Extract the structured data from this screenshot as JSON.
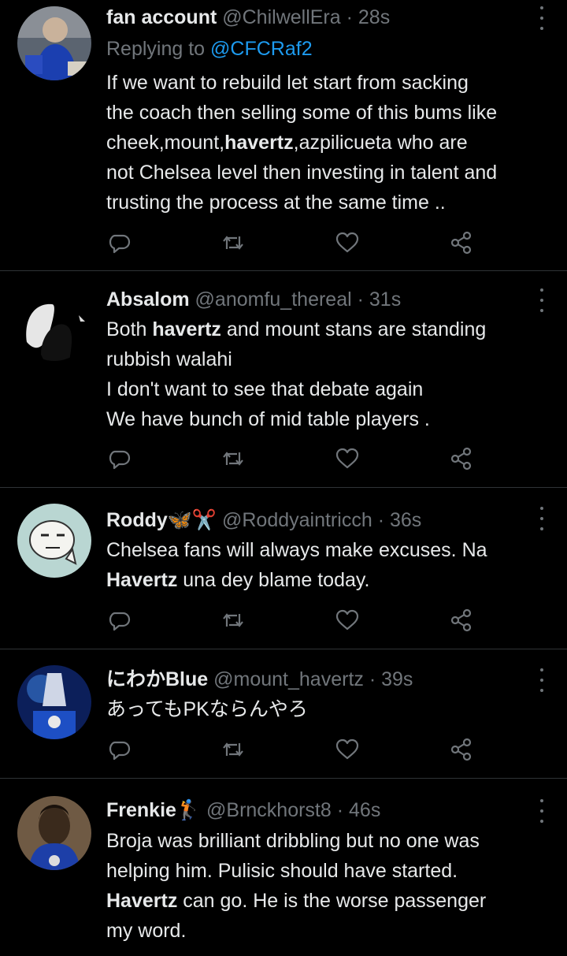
{
  "tweets": [
    {
      "name": "fan account",
      "handle": "@ChilwellEra",
      "dot": "·",
      "time": "28s",
      "reply_prefix": "Replying to ",
      "reply_handle": "@CFCRaf2",
      "lines": [
        [
          "If we want to rebuild let start from sacking"
        ],
        [
          "the coach then selling some of this bums like"
        ],
        [
          "cheek,mount,",
          "havertz",
          ",azpilicueta who are"
        ],
        [
          "not Chelsea level then investing in talent and"
        ],
        [
          "trusting the process at the same time .."
        ]
      ]
    },
    {
      "name": "Absalom",
      "handle": "@anomfu_thereal",
      "dot": "·",
      "time": "31s",
      "lines": [
        [
          "Both ",
          "havertz",
          " and mount stans are standing"
        ],
        [
          "rubbish walahi"
        ],
        [
          "I don't want to see that debate again"
        ],
        [
          "We have bunch of mid table players  ."
        ]
      ]
    },
    {
      "name": "Roddy🦋✂️",
      "handle": "@Roddyaintricch",
      "dot": "·",
      "time": "36s",
      "lines": [
        [
          "Chelsea fans will always make excuses. Na"
        ],
        [
          "",
          "Havertz",
          " una dey blame today."
        ]
      ]
    },
    {
      "name": "にわかBlue",
      "handle": "@mount_havertz",
      "dot": "·",
      "time": "39s",
      "lines": [
        [
          "あってもPKならんやろ"
        ]
      ]
    },
    {
      "name": "Frenkie🏌",
      "handle": "@Brnckhorst8",
      "dot": "·",
      "time": "46s",
      "lines": [
        [
          "Broja was brilliant dribbling but no one was"
        ],
        [
          "helping him. Pulisic should have started."
        ],
        [
          "",
          "Havertz",
          " can go. He is the worse passenger"
        ],
        [
          "my word."
        ]
      ]
    }
  ],
  "icons": {
    "reply": "reply-icon",
    "retweet": "retweet-icon",
    "like": "like-icon",
    "share": "share-icon",
    "more": "more-icon"
  },
  "colors": {
    "background": "#000000",
    "text": "#e7e9ea",
    "muted": "#71767b",
    "link": "#1d9bf0",
    "divider": "#2f3336"
  }
}
